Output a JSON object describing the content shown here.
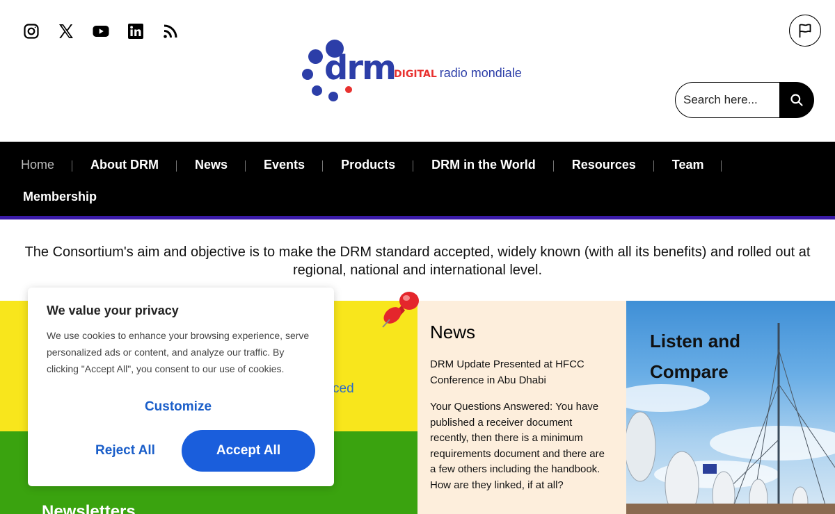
{
  "header": {
    "social": [
      {
        "name": "instagram-icon"
      },
      {
        "name": "x-twitter-icon"
      },
      {
        "name": "youtube-icon"
      },
      {
        "name": "linkedin-icon"
      },
      {
        "name": "rss-icon"
      }
    ],
    "logo": {
      "word": "drm",
      "digital": "DIGITAL",
      "rest": "radio mondiale"
    },
    "flag_icon": "flag-icon",
    "search": {
      "placeholder": "Search here...",
      "icon": "search-icon"
    }
  },
  "nav": {
    "row1": [
      {
        "label": "Home",
        "active": true
      },
      {
        "label": "About DRM"
      },
      {
        "label": "News"
      },
      {
        "label": "Events"
      },
      {
        "label": "Products"
      },
      {
        "label": "DRM in the World"
      },
      {
        "label": "Resources"
      },
      {
        "label": "Team"
      }
    ],
    "row2": [
      {
        "label": "Membership"
      }
    ]
  },
  "tagline": "The Consortium's aim and objective is to make the DRM standard accepted, widely known (with all its benefits) and rolled out at regional, national and international level.",
  "tiles": {
    "yellow_link_fragment": "ced",
    "green_title": "Newsletters",
    "news": {
      "title": "News",
      "items": [
        "DRM Update Presented at HFCC Conference in Abu Dhabi",
        "Your Questions Answered: You have published a receiver document recently, then there is a minimum requirements document and there are a few others including the handbook. How are they linked, if at all?"
      ]
    },
    "listen": {
      "title": "Listen and Compare"
    }
  },
  "cookie": {
    "title": "We value your privacy",
    "body": "We use cookies to enhance your browsing experience, serve personalized ads or content, and analyze our traffic. By clicking \"Accept All\", you consent to our use of cookies.",
    "customize": "Customize",
    "reject": "Reject All",
    "accept": "Accept All"
  },
  "colors": {
    "brand_blue": "#2c3ea8",
    "brand_red": "#e8312f",
    "nav_bg": "#000000",
    "nav_underline": "#3a1aa8",
    "accent_button": "#1a5edc",
    "tile_yellow": "#f8e61c",
    "tile_green": "#3aa30f",
    "tile_news": "#fdeedc"
  }
}
